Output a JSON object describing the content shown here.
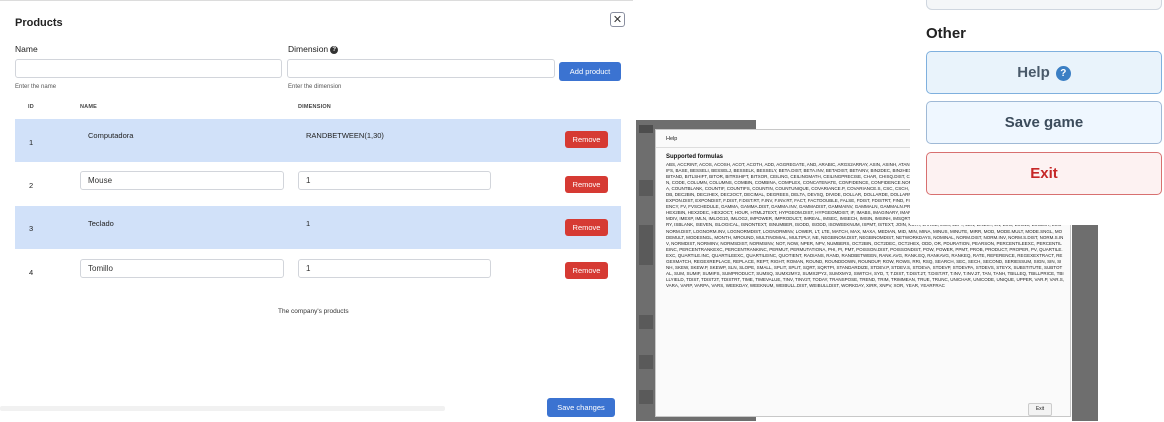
{
  "products": {
    "title": "Products",
    "close_glyph": "✕",
    "name_label": "Name",
    "name_hint": "Enter the name",
    "dimension_label": "Dimension",
    "dimension_help_glyph": "?",
    "dimension_hint": "Enter the dimension",
    "add_button": "Add product",
    "columns": [
      "ID",
      "NAME",
      "DIMENSION"
    ],
    "rows": [
      {
        "id": "1",
        "name": "Computadora",
        "dimension": "RANDBETWEEN(1,30)",
        "remove": "Remove"
      },
      {
        "id": "2",
        "name": "Mouse",
        "dimension": "1",
        "remove": "Remove"
      },
      {
        "id": "3",
        "name": "Teclado",
        "dimension": "1",
        "remove": "Remove"
      },
      {
        "id": "4",
        "name": "Tomillo",
        "dimension": "1",
        "remove": "Remove"
      }
    ],
    "caption": "The company's products",
    "save_button": "Save changes"
  },
  "help_dialog": {
    "title": "Help",
    "subtitle": "Supported formulas",
    "formulas": "ABS, ACCRINT, ACOS, ACOSH, ACOT, ACOTH, ADD, AGGREGATE, AND, ARABIC, ARGS2ARRAY, ASIN, ASINH, ATAN, ATAN2, ATANH, AVEDEV, AVERAGE, AVERAGEA, AVERAGEIF, AVERAGEIFS, BASE, BESSELI, BESSELJ, BESSELK, BESSELY, BETA.DIST, BETA.INV, BETADIST, BETAINV, BIN2DEC, BIN2HEX, BIN2OCT, BINOM.DIST, BINOM.DIST.RANGE, BINOM.INV, BINOMDIST, BITAND, BITLSHIFT, BITOR, BITRSHIFT, BITXOR, CEILING, CEILINGMATH, CEILINGPRECISE, CHAR, CHISQ.DIST, CHISQ.DIST.RT, CHISQ.INV, CHISQ.INV.RT, CHISQ.TEST, CHOOSE, CLEAN, CODE, COLUMN, COLUMNS, COMBIN, COMBINA, COMPLEX, CONCATENATE, CONFIDENCE, CONFIDENCE.NORM, CONFIDENCE.T, CORREL, COS, COSH, COT, COTH, COUNT, COUNTA, COUNTBLANK, COUNTIF, COUNTIFS, COUNTIN, COUNTUNIQUE, COVARIANCE.P, COVARIANCE.S, CSC, CSCH, CUMIPMT, CUMPRINC, DATE, DATEVALUE, DAY, DAYS, DAYS360, DB, DDB, DEC2BIN, DEC2HEX, DEC2OCT, DECIMAL, DEGREES, DELTA, DEVSQ, DIVIDE, DOLLAR, DOLLARDE, DOLLARFR, E, EDATE, EFFECT, EOMONTH, EQ, ERF, ERFC, EVEN, EXACT, EXP, EXPON.DIST, EXPONDIST, F.DIST, F.DIST.RT, F.INV, F.INV.RT, FACT, FACTDOUBLE, FALSE, FDIST, FDISTRT, FIND, FINV, FINVRT, FISHER, FISHERINV, FLATTEN, FLOOR, FORECAST, FREQUENCY, FV, FVSCHEDULE, GAMMA, GAMMA.DIST, GAMMA.INV, GAMMADIST, GAMMAINV, GAMMALN, GAMMALN.PRECISE, GAUSS, GCD, GEOMEAN, GESTEP, GROWTH, GTE, HARMEAN, HEX2BIN, HEX2DEC, HEX2OCT, HOUR, HTML2TEXT, HYPGEOM.DIST, HYPGEOMDIST, IF, IMABS, IMAGINARY, IMARGUMENT, IMCONJUGATE, IMCOS, IMCOSH, IMCOT, IMCSC, IMCSCH, IMDIV, IMEXP, IMLN, IMLOG10, IMLOG2, IMPOWER, IMPRODUCT, IMREAL, IMSEC, IMSECH, IMSIN, IMSINH, IMSQRT, IMSUB, IMSUM, IMTAN, INT, INTERCEPT, INTERVAL, IPMT, IRR, ISBINARY, ISBLANK, ISEVEN, ISLOGICAL, ISNONTEXT, ISNUMBER, ISODD, ISODD, ISOWEEKNUM, ISPMT, ISTEXT, JOIN, KURT, LARGE, LCM, LEFT, LEN, LINEST, LN, LOG, LOG10, LOGEST, LOGNORM.DIST, LOGNORM.INV, LOGNORMDIST, LOGNORMINV, LOWER, LT, LTE, MATCH, MAX, MAXA, MEDIAN, MID, MIN, MINA, MINUS, MINUTE, MIRR, MOD, MODE.MULT, MODE.SNGL, MODEMULT, MODESNGL, MONTH, MROUND, MULTINOMIAL, MULTIPLY, NE, NEGBINOM.DIST, NEGBINOMDIST, NETWORKDAYS, NOMINAL, NORM.DIST, NORM.INV, NORM.S.DIST, NORM.S.INV, NORMDIST, NORMINV, NORMSDIST, NORMSINV, NOT, NOW, NPER, NPV, NUMBERS, OCT2BIN, OCT2DEC, OCT2HEX, ODD, OR, PDURATION, PEARSON, PERCENTILEEXC, PERCENTILEINC, PERCENTRANKEXC, PERCENTRANKINC, PERMUT, PERMUTATIONA, PHI, PI, PMT, POISSON.DIST, POISSONDIST, POW, POWER, PPMT, PROB, PRODUCT, PROPER, PV, QUARTILE.EXC, QUARTILE.INC, QUARTILEEXC, QUARTILEINC, QUOTIENT, RADIANS, RAND, RANDBETWEEN, RANK.AVG, RANK.EQ, RANKAVG, RANKEQ, RATE, REFERENCE, REGEXEXTRACT, REGEXMATCH, REGEXREPLACE, REPLACE, REPT, RIGHT, ROMAN, ROUND, ROUNDDOWN, ROUNDUP, ROW, ROWS, RRI, RSQ, SEARCH, SEC, SECH, SECOND, SERIESSUM, SIGN, SIN, SINH, SKEW, SKEW.P, SKEWP, SLN, SLOPE, SMALL, SPLIT, SPLIT, SQRT, SQRTPI, STANDARDIZE, STDEV.P, STDEV.S, STDEVA, STDEVP, STDEVPA, STDEVS, STEYX, SUBSTITUTE, SUBTOTAL, SUM, SUMIF, SUMIFS, SUMPRODUCT, SUMSQ, SUMX2MY2, SUMX2PY2, SUMXMY2, SWITCH, SYD, T, T.DIST, T.DIST.2T, T.DIST.RT, T.INV, T.INV.2T, TAN, TANH, TBILLEQ, TBILLPRICE, TBILLYIELD, TDIST, TDIST2T, TDISTRT, TIME, TIMEVALUE, TINV, TINV2T, TODAY, TRANSPOSE, TREND, TRIM, TRIMMEAN, TRUE, TRUNC, UNICHAR, UNICODE, UNIQUE, UPPER, VAR.P, VAR.S, VARA, VARP, VARPA, VARS, WEEKDAY, WEEKNUM, WEIBULL.DIST, WEIBULLDIST, WORKDAY, XIRR, XNPV, XOR, YEAR, YEARFRAC",
    "exit_button": "Exit"
  },
  "other_menu": {
    "title": "Other",
    "help_button": "Help",
    "help_icon_glyph": "?",
    "save_button": "Save game",
    "exit_button": "Exit"
  },
  "colors": {
    "primary_blue": "#3b73d1",
    "remove_red": "#d63a33",
    "row_highlight": "#d1e1f9",
    "exit_red": "#c62828"
  }
}
